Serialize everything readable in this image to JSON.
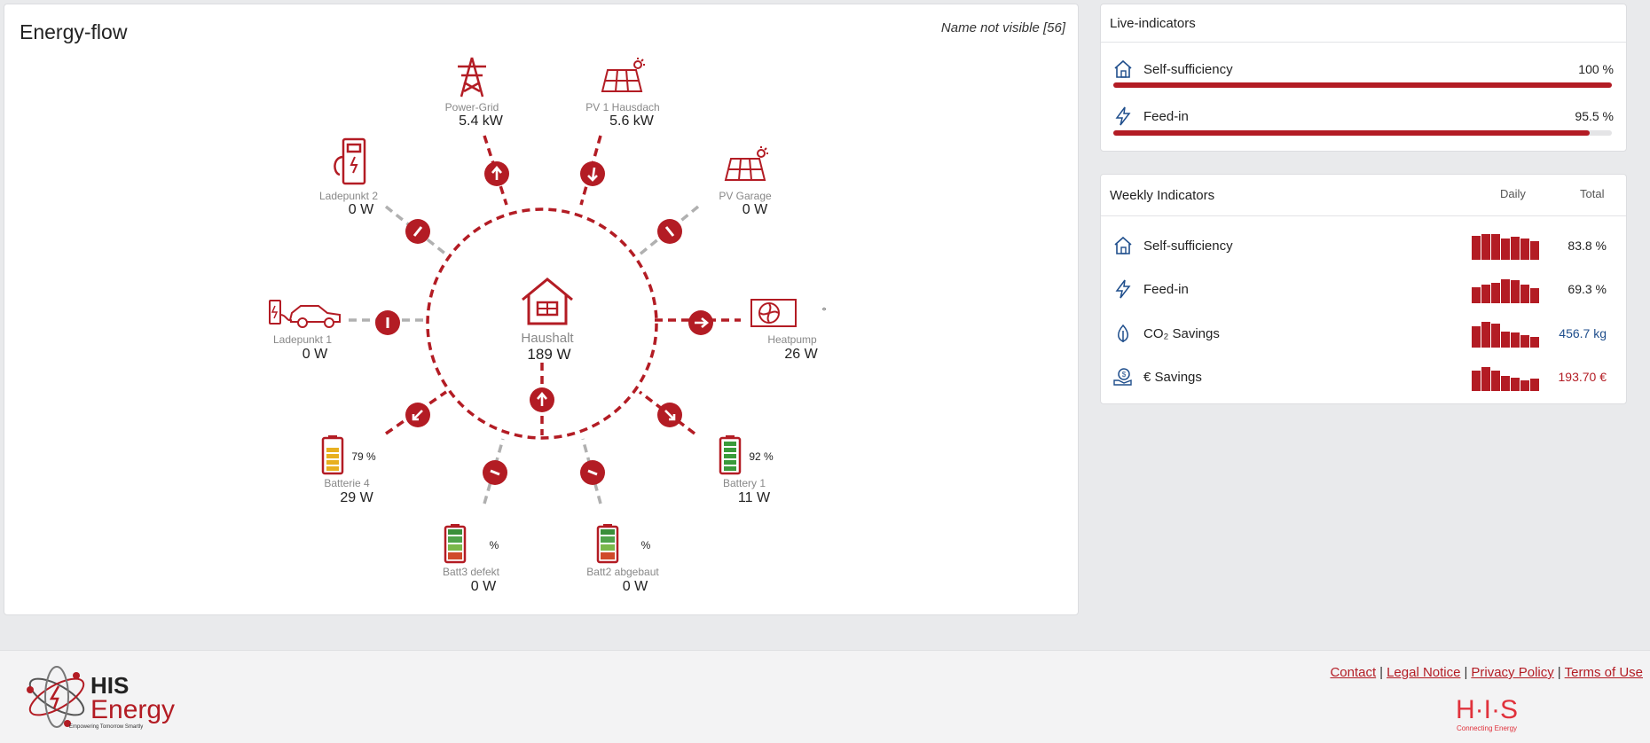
{
  "energy_flow": {
    "title": "Energy-flow",
    "note": "Name not visible [56]",
    "center": {
      "name": "Haushalt",
      "value": "189 W"
    },
    "nodes": {
      "power_grid": {
        "name": "Power-Grid",
        "value": "5.4  kW"
      },
      "pv1": {
        "name": "PV 1 Hausdach",
        "value": "5.6  kW"
      },
      "pv_garage": {
        "name": "PV Garage",
        "value": "0  W"
      },
      "heatpump": {
        "name": "Heatpump",
        "value": "26  W"
      },
      "battery1": {
        "name": "Battery 1",
        "value": "11  W",
        "percent": "92 %"
      },
      "batt2": {
        "name": "Batt2 abgebaut",
        "value": "0  W",
        "percent": "%"
      },
      "batt3": {
        "name": "Batt3 defekt",
        "value": "0  W",
        "percent": "%"
      },
      "batterie4": {
        "name": "Batterie 4",
        "value": "29  W",
        "percent": "79 %"
      },
      "ladepunkt1": {
        "name": "Ladepunkt 1",
        "value": "0  W"
      },
      "ladepunkt2": {
        "name": "Ladepunkt 2",
        "value": "0  W"
      }
    },
    "heatpump_marker": "°",
    "battery_levels": {
      "battery1": 0.92,
      "batterie4": 0.79
    }
  },
  "live": {
    "title": "Live-indicators",
    "rows": [
      {
        "label": "Self-sufficiency",
        "value": "100 %",
        "fraction": 1.0,
        "icon": "house-icon"
      },
      {
        "label": "Feed-in",
        "value": "95.5 %",
        "fraction": 0.955,
        "icon": "lightning-icon"
      }
    ]
  },
  "weekly": {
    "title": "Weekly Indicators",
    "col_daily": "Daily",
    "col_total": "Total",
    "rows": [
      {
        "label": "Self-sufficiency",
        "value": "83.8 %",
        "icon": "house-icon",
        "color": "#222222",
        "bars": [
          0.9,
          0.95,
          0.95,
          0.8,
          0.85,
          0.8,
          0.7
        ]
      },
      {
        "label": "Feed-in",
        "value": "69.3 %",
        "icon": "lightning-icon",
        "color": "#222222",
        "bars": [
          0.6,
          0.7,
          0.75,
          0.9,
          0.85,
          0.7,
          0.55
        ]
      },
      {
        "label": "CO₂ Savings",
        "value": "456.7 kg",
        "icon": "leaf-icon",
        "color": "#1f4e8c",
        "bars": [
          0.8,
          0.95,
          0.9,
          0.6,
          0.55,
          0.45,
          0.4
        ]
      },
      {
        "label": "€ Savings",
        "value": "193.70 €",
        "icon": "money-icon",
        "color": "#b31c24",
        "bars": [
          0.75,
          0.9,
          0.75,
          0.55,
          0.5,
          0.4,
          0.45
        ]
      }
    ]
  },
  "colors": {
    "accent": "#b31c24",
    "grey_line": "#b0b0b0"
  },
  "footer": {
    "links": [
      "Contact",
      "Legal Notice",
      "Privacy Policy",
      "Terms of Use"
    ],
    "separator": "|",
    "logo_text": "HIS",
    "logo_text2": "Energy",
    "logo_tagline": "Empowering Tomorrow Smartly",
    "brand_text": "H·I·S",
    "brand_tagline": "Connecting Energy"
  }
}
